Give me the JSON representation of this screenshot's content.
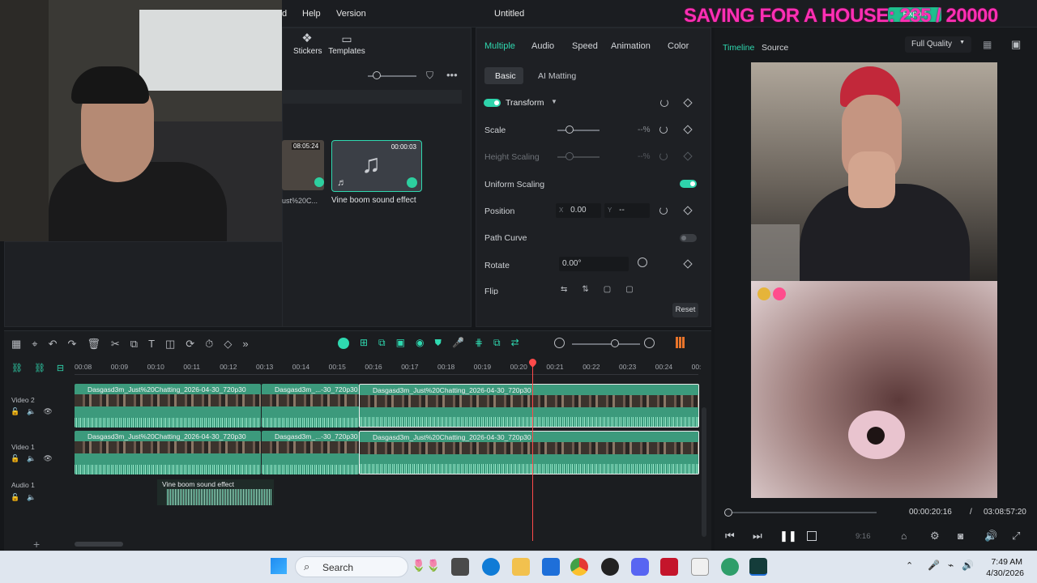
{
  "titlebar": {
    "menu_partial": "d",
    "menu_help": "Help",
    "menu_version": "Version",
    "title": "Untitled",
    "export": "Export"
  },
  "banner": "SAVING FOR A HOUSE: 235 / 20000",
  "media": {
    "stickers": "Stickers",
    "templates": "Templates",
    "clip1_duration": "08:05:24",
    "clip1_name": "ust%20C...",
    "clip2_duration": "00:00:03",
    "clip2_name": "Vine boom sound effect"
  },
  "props": {
    "tabs": [
      "Multiple",
      "Audio",
      "Speed",
      "Animation",
      "Color"
    ],
    "subtabs": [
      "Basic",
      "AI Matting"
    ],
    "transform": "Transform",
    "scale": "Scale",
    "scale_val": "--%",
    "height_scaling": "Height Scaling",
    "height_val": "--%",
    "uniform_scaling": "Uniform Scaling",
    "position": "Position",
    "pos_x_label": "X",
    "pos_x": "0.00",
    "pos_y_label": "Y",
    "pos_y": "--",
    "path_curve": "Path Curve",
    "rotate": "Rotate",
    "rotate_val": "0.00°",
    "flip": "Flip",
    "reset": "Reset"
  },
  "preview": {
    "tab_timeline": "Timeline",
    "tab_source": "Source",
    "quality": "Full Quality",
    "current_time": "00:00:20:16",
    "separator": "/",
    "total_time": "03:08:57:20",
    "aspect": "9:16"
  },
  "timeline": {
    "ruler": [
      "00:08",
      "00:09",
      "00:10",
      "00:11",
      "00:12",
      "00:13",
      "00:14",
      "00:15",
      "00:16",
      "00:17",
      "00:18",
      "00:19",
      "00:20",
      "00:21",
      "00:22",
      "00:23",
      "00:24",
      "00:"
    ],
    "tracks": {
      "video2": "Video 2",
      "video1": "Video 1",
      "audio1": "Audio 1"
    },
    "clip_a": "Dasgasd3m_Just%20Chatting_2026-04-30_720p30",
    "clip_b": "Dasgasd3m_...-30_720p30",
    "clip_c": "Dasgasd3m_Just%20Chatting_2026-04-30_720p30",
    "audio_clip": "Vine boom sound effect"
  },
  "taskbar": {
    "search": "Search",
    "time": "7:49 AM",
    "date": "4/30/2026"
  }
}
